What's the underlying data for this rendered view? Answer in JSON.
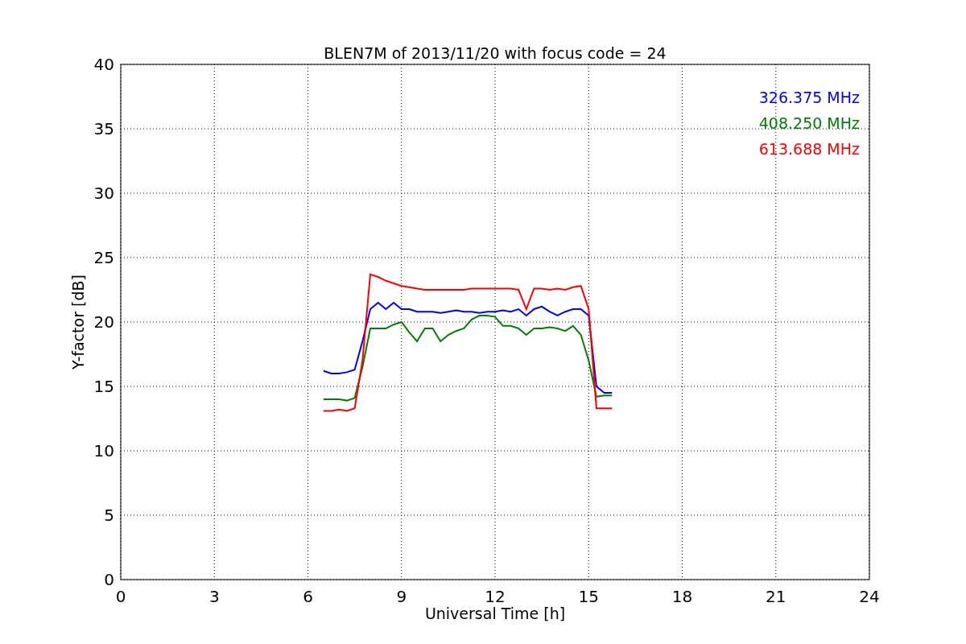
{
  "figure": {
    "chart_data": {
      "type": "line",
      "title": "BLEN7M of 2013/11/20 with focus code = 24",
      "xlabel": "Universal Time [h]",
      "ylabel": "Y-factor [dB]",
      "x": [
        6.5,
        6.75,
        7,
        7.25,
        7.5,
        7.75,
        8,
        8.25,
        8.5,
        8.75,
        9,
        9.25,
        9.5,
        9.75,
        10,
        10.25,
        10.5,
        10.75,
        11,
        11.25,
        11.5,
        11.75,
        12,
        12.25,
        12.5,
        12.75,
        13,
        13.25,
        13.5,
        13.75,
        14,
        14.25,
        14.5,
        14.75,
        15,
        15.25,
        15.5,
        15.75
      ],
      "series": [
        {
          "name": "326.375 MHz",
          "color": "#0000ff",
          "values": [
            16.2,
            16,
            16,
            16.1,
            16.3,
            18.5,
            21,
            21.5,
            21,
            21.5,
            21,
            21,
            20.8,
            20.8,
            20.8,
            20.7,
            20.8,
            20.9,
            20.8,
            20.8,
            20.7,
            20.8,
            20.8,
            20.9,
            20.8,
            21,
            20.5,
            21,
            21.2,
            20.8,
            20.5,
            20.8,
            21,
            21,
            20.5,
            15,
            14.5,
            14.5
          ]
        },
        {
          "name": "408.250 MHz",
          "color": "#008000",
          "values": [
            14,
            14,
            14,
            13.9,
            14.1,
            16.5,
            19.5,
            19.5,
            19.5,
            19.8,
            20,
            19.2,
            18.5,
            19.5,
            19.5,
            18.5,
            19,
            19.3,
            19.5,
            20.2,
            20.5,
            20.5,
            20.4,
            19.7,
            19.7,
            19.5,
            19,
            19.5,
            19.5,
            19.6,
            19.5,
            19.3,
            19.7,
            19,
            17,
            14.2,
            14.3,
            14.3
          ]
        },
        {
          "name": "613.688 MHz",
          "color": "#ff0000",
          "values": [
            13.1,
            13.1,
            13.2,
            13.1,
            13.3,
            17,
            23.7,
            23.5,
            23.2,
            23,
            22.8,
            22.7,
            22.6,
            22.5,
            22.5,
            22.5,
            22.5,
            22.5,
            22.5,
            22.6,
            22.6,
            22.6,
            22.6,
            22.6,
            22.6,
            22.5,
            21,
            22.6,
            22.6,
            22.5,
            22.6,
            22.5,
            22.7,
            22.8,
            21,
            13.3,
            13.3,
            13.3
          ]
        }
      ],
      "grid": true,
      "xlim": [
        0,
        24
      ],
      "ylim": [
        0,
        40
      ],
      "xticks": [
        0,
        3,
        6,
        9,
        12,
        15,
        18,
        21,
        24
      ],
      "yticks": [
        0,
        5,
        10,
        15,
        20,
        25,
        30,
        35,
        40
      ]
    }
  }
}
